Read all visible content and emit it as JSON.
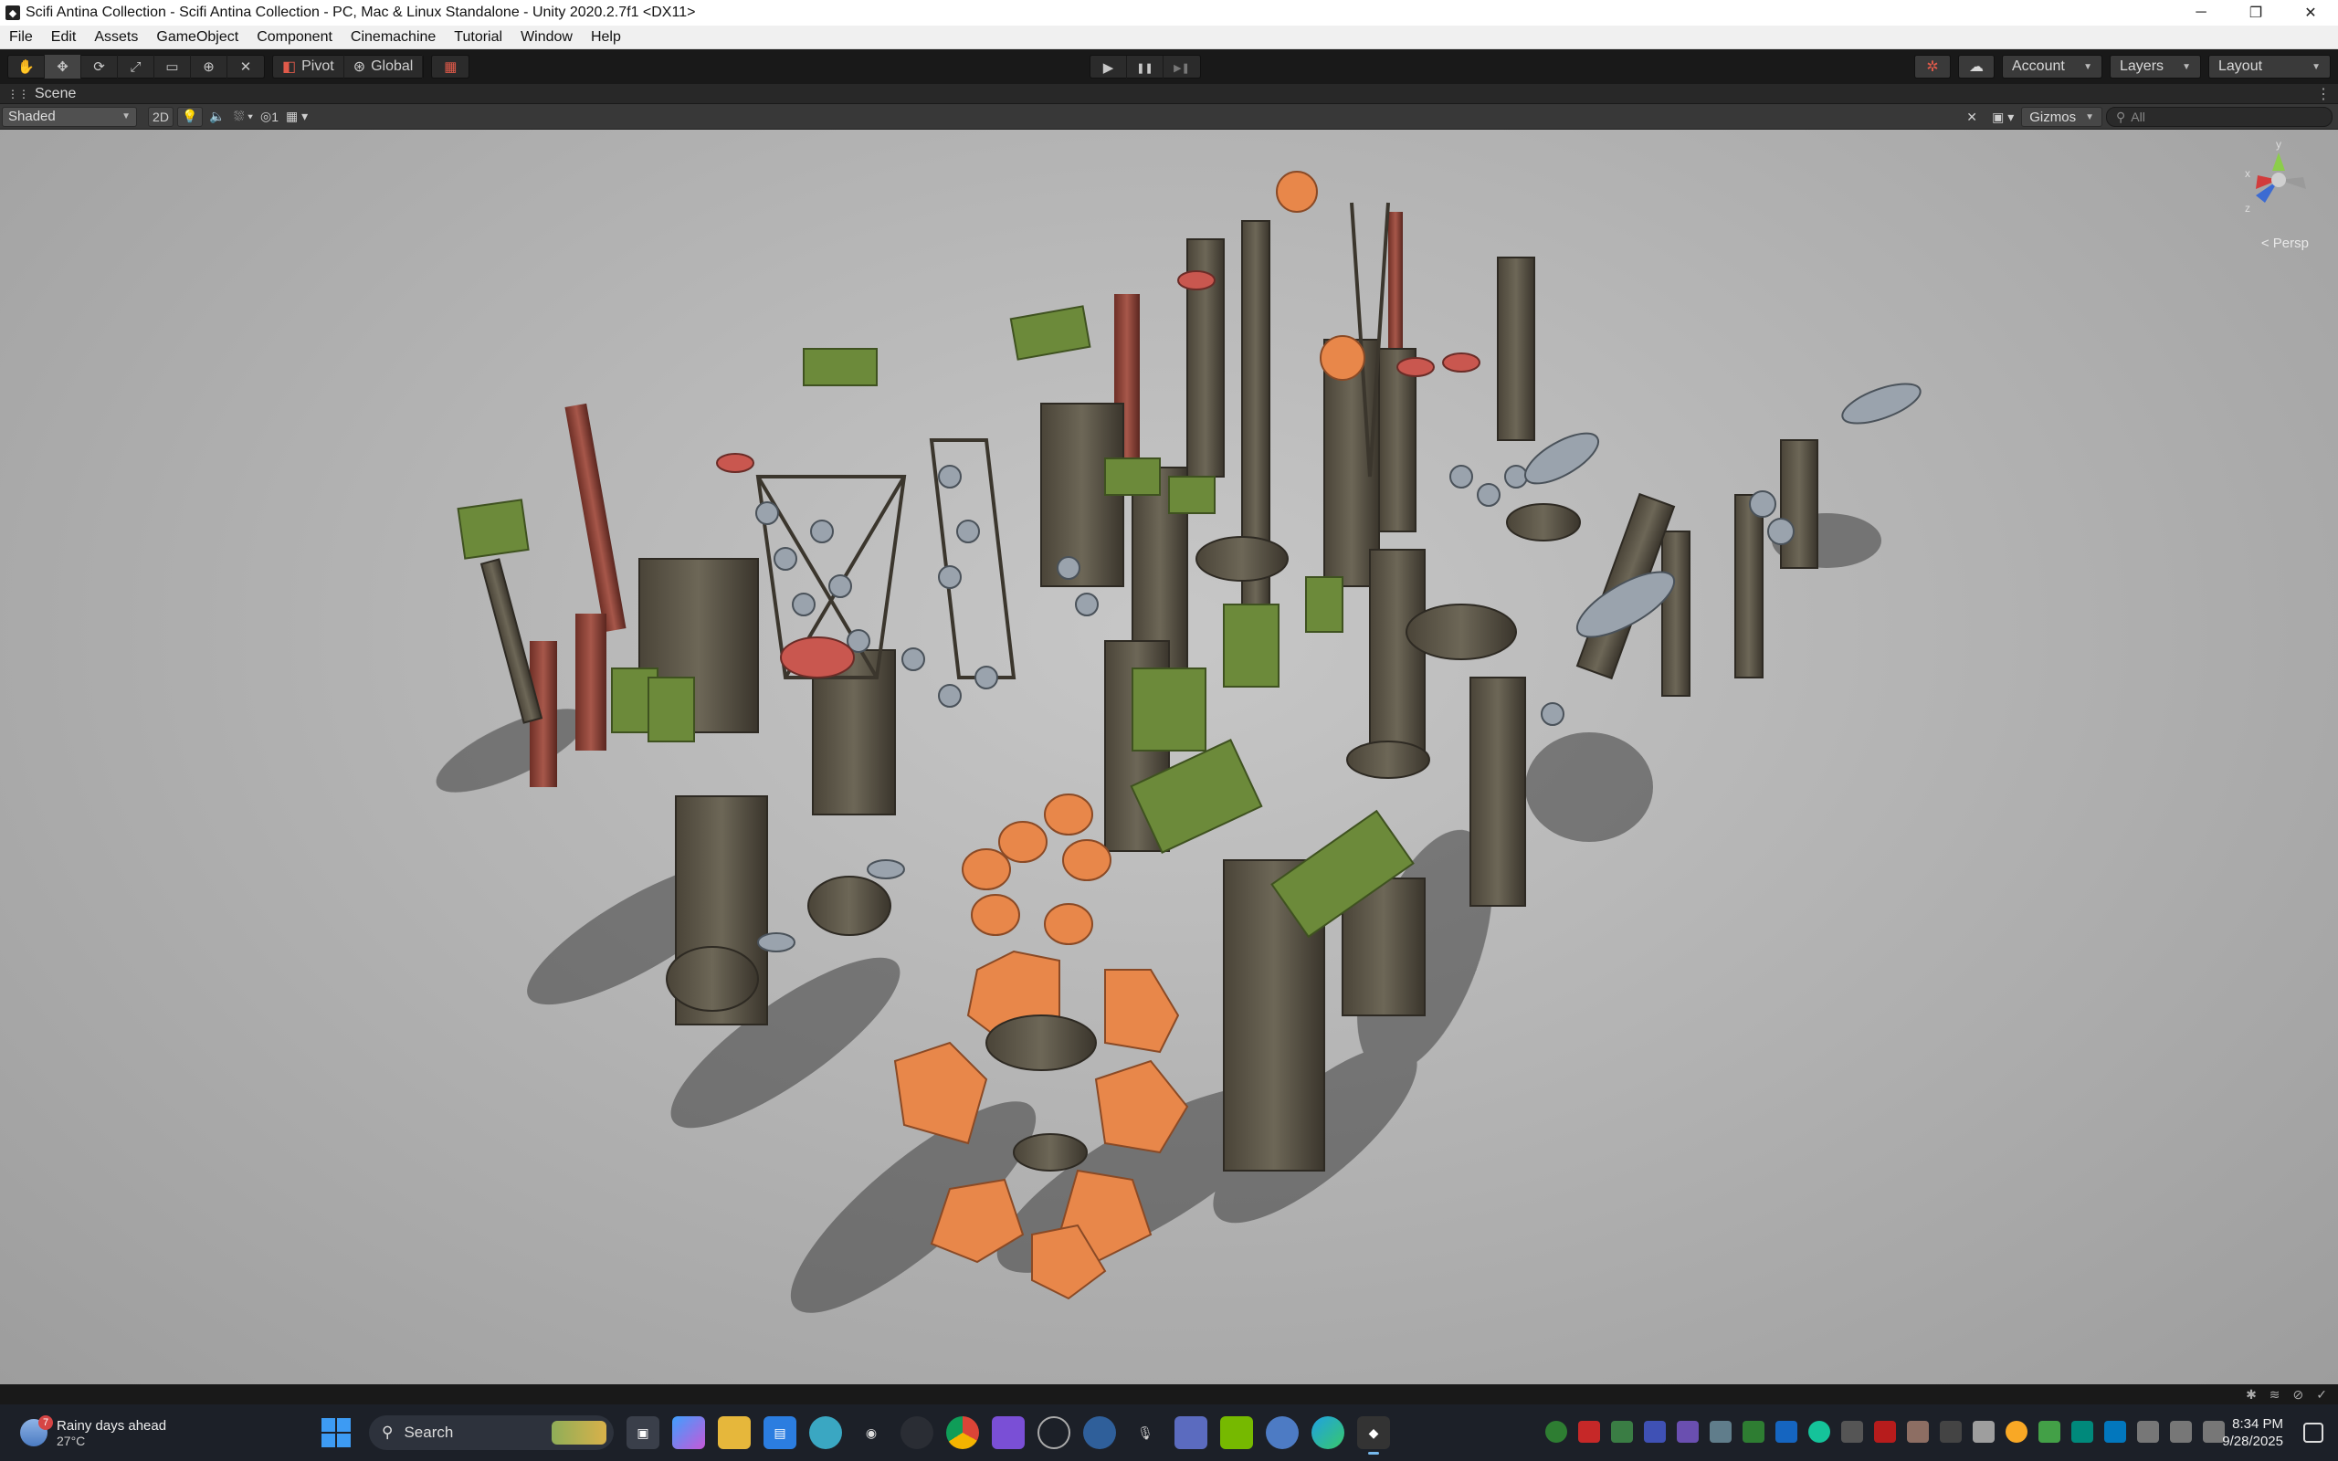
{
  "window": {
    "title": "Scifi Antina Collection - Scifi Antina Collection - PC, Mac & Linux Standalone - Unity 2020.2.7f1 <DX11>",
    "controls": {
      "minimize": "─",
      "maximize": "❐",
      "close": "✕"
    }
  },
  "menu": [
    "File",
    "Edit",
    "Assets",
    "GameObject",
    "Component",
    "Cinemachine",
    "Tutorial",
    "Window",
    "Help"
  ],
  "toolbar": {
    "tools": [
      {
        "name": "hand-tool-icon",
        "glyph": "✋"
      },
      {
        "name": "move-tool-icon",
        "glyph": "✥"
      },
      {
        "name": "rotate-tool-icon",
        "glyph": "⟳"
      },
      {
        "name": "scale-tool-icon",
        "glyph": "⤢"
      },
      {
        "name": "rect-tool-icon",
        "glyph": "▭"
      },
      {
        "name": "transform-tool-icon",
        "glyph": "⊕"
      },
      {
        "name": "custom-tool-icon",
        "glyph": "✕"
      }
    ],
    "pivot_label": "Pivot",
    "global_label": "Global",
    "play": "▶",
    "pause": "❚❚",
    "step": "▶❚",
    "account_label": "Account",
    "layers_label": "Layers",
    "layout_label": "Layout"
  },
  "scene": {
    "tab_label": "Scene",
    "shading_mode": "Shaded",
    "mode_2d": "2D",
    "hidden_count": "1",
    "gizmos_label": "Gizmos",
    "search_placeholder": "All",
    "persp_label": "< Persp",
    "gizmo_axes": {
      "y": "y",
      "x": "x",
      "z": "z"
    }
  },
  "taskbar": {
    "weather_title": "Rainy days ahead",
    "weather_temp": "27°C",
    "weather_badge": "7",
    "search_label": "Search",
    "time": "8:34 PM",
    "date": "9/28/2025"
  },
  "colors": {
    "accent": "#3d9bf3",
    "panel_orange": "#e8874a",
    "panel_green": "#6c8a3a",
    "tower_red": "#9c4a3c"
  }
}
